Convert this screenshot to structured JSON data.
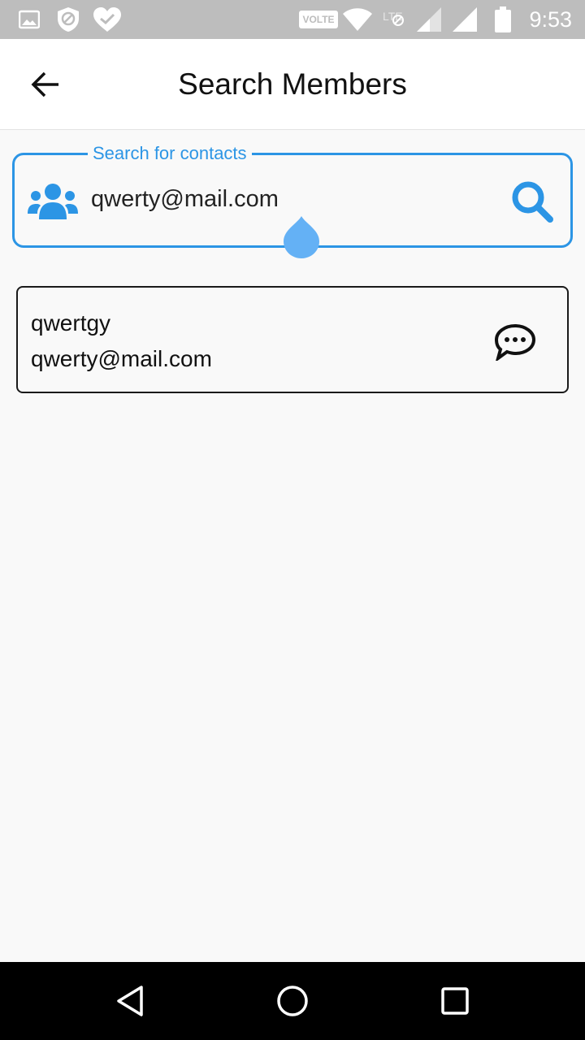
{
  "status_bar": {
    "time": "9:53",
    "volte": "VOLTE",
    "icons": [
      "image-icon",
      "vpn-shield-icon",
      "heart-check-icon",
      "wifi-icon",
      "lte-icon",
      "signal-icon",
      "signal-icon",
      "battery-icon"
    ]
  },
  "header": {
    "title": "Search Members",
    "back_icon": "arrow-left-icon"
  },
  "search": {
    "label": "Search for contacts",
    "value": "qwerty@mail.com",
    "leading_icon": "contacts-icon",
    "trailing_icon": "search-icon"
  },
  "results": [
    {
      "name": "qwertgy",
      "email": "qwerty@mail.com",
      "action_icon": "chat-icon"
    }
  ],
  "nav": {
    "icons": [
      "back-triangle-icon",
      "home-circle-icon",
      "recents-square-icon"
    ]
  },
  "colors": {
    "accent": "#2c95e5",
    "status_bar": "#bdbdbd",
    "nav_bar": "#000000",
    "background": "#f9f9f9"
  }
}
